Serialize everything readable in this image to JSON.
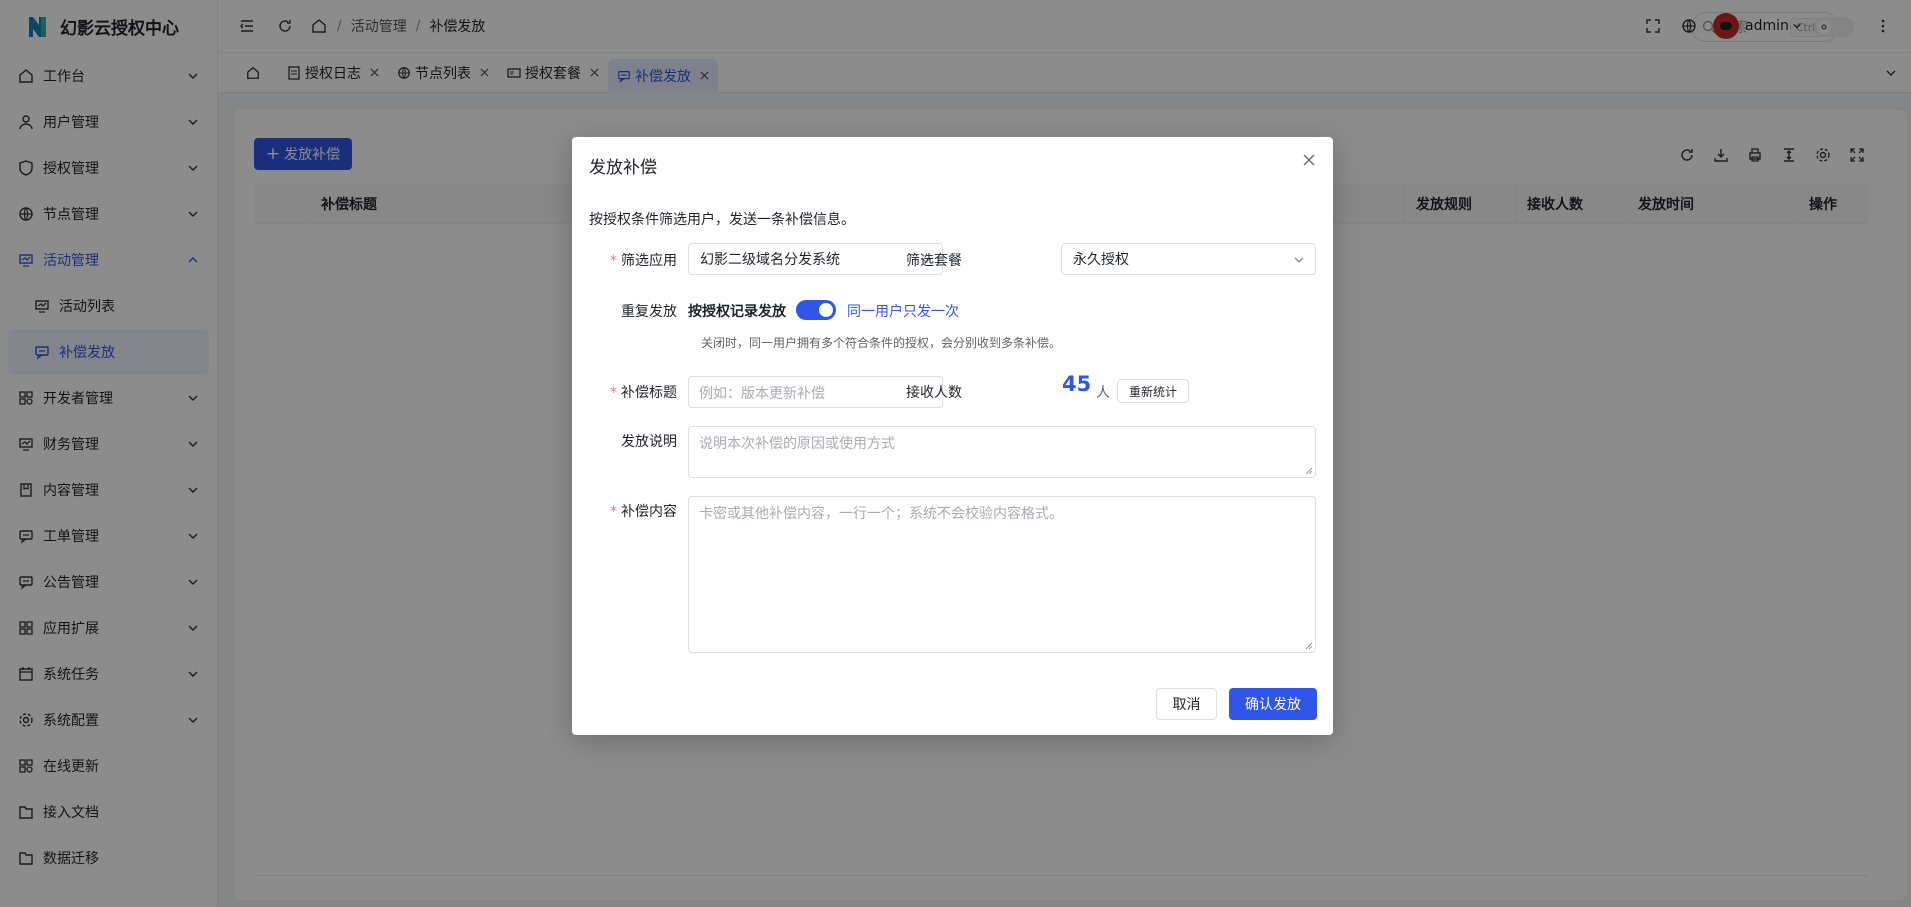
{
  "brand": {
    "name": "幻影云授权中心"
  },
  "sidebar": {
    "items": [
      {
        "label": "工作台"
      },
      {
        "label": "用户管理"
      },
      {
        "label": "授权管理"
      },
      {
        "label": "节点管理"
      },
      {
        "label": "活动管理"
      },
      {
        "label": "开发者管理"
      },
      {
        "label": "财务管理"
      },
      {
        "label": "内容管理"
      },
      {
        "label": "工单管理"
      },
      {
        "label": "公告管理"
      },
      {
        "label": "应用扩展"
      },
      {
        "label": "系统任务"
      },
      {
        "label": "系统配置"
      },
      {
        "label": "在线更新"
      },
      {
        "label": "接入文档"
      },
      {
        "label": "数据迁移"
      }
    ],
    "sub": [
      {
        "label": "活动列表"
      },
      {
        "label": "补偿发放"
      }
    ]
  },
  "header": {
    "breadcrumb": [
      "活动管理",
      "补偿发放"
    ],
    "search_placeholder": "搜索",
    "search_shortcut": "Ctrl K",
    "user": "admin"
  },
  "tabs": [
    {
      "label": "授权日志"
    },
    {
      "label": "节点列表"
    },
    {
      "label": "授权套餐"
    },
    {
      "label": "补偿发放"
    }
  ],
  "page": {
    "add_button": "发放补偿",
    "columns": [
      "补偿标题",
      "发放规则",
      "接收人数",
      "发放时间",
      "操作"
    ]
  },
  "modal": {
    "title": "发放补偿",
    "description": "按授权条件筛选用户，发送一条补偿信息。",
    "filter_app_label": "筛选应用",
    "filter_app_value": "幻影二级域名分发系统",
    "filter_plan_label": "筛选套餐",
    "filter_plan_value": "永久授权",
    "repeat_label": "重复发放",
    "repeat_left": "按授权记录发放",
    "repeat_right": "同一用户只发一次",
    "repeat_hint": "关闭时，同一用户拥有多个符合条件的授权，会分别收到多条补偿。",
    "title_label": "补偿标题",
    "title_placeholder": "例如：版本更新补偿",
    "recipients_label": "接收人数",
    "recipients_count": "45",
    "recipients_unit": "人",
    "recount_button": "重新统计",
    "note_label": "发放说明",
    "note_placeholder": "说明本次补偿的原因或使用方式",
    "content_label": "补偿内容",
    "content_placeholder": "卡密或其他补偿内容，一行一个；系统不会校验内容格式。",
    "cancel": "取消",
    "confirm": "确认发放"
  }
}
